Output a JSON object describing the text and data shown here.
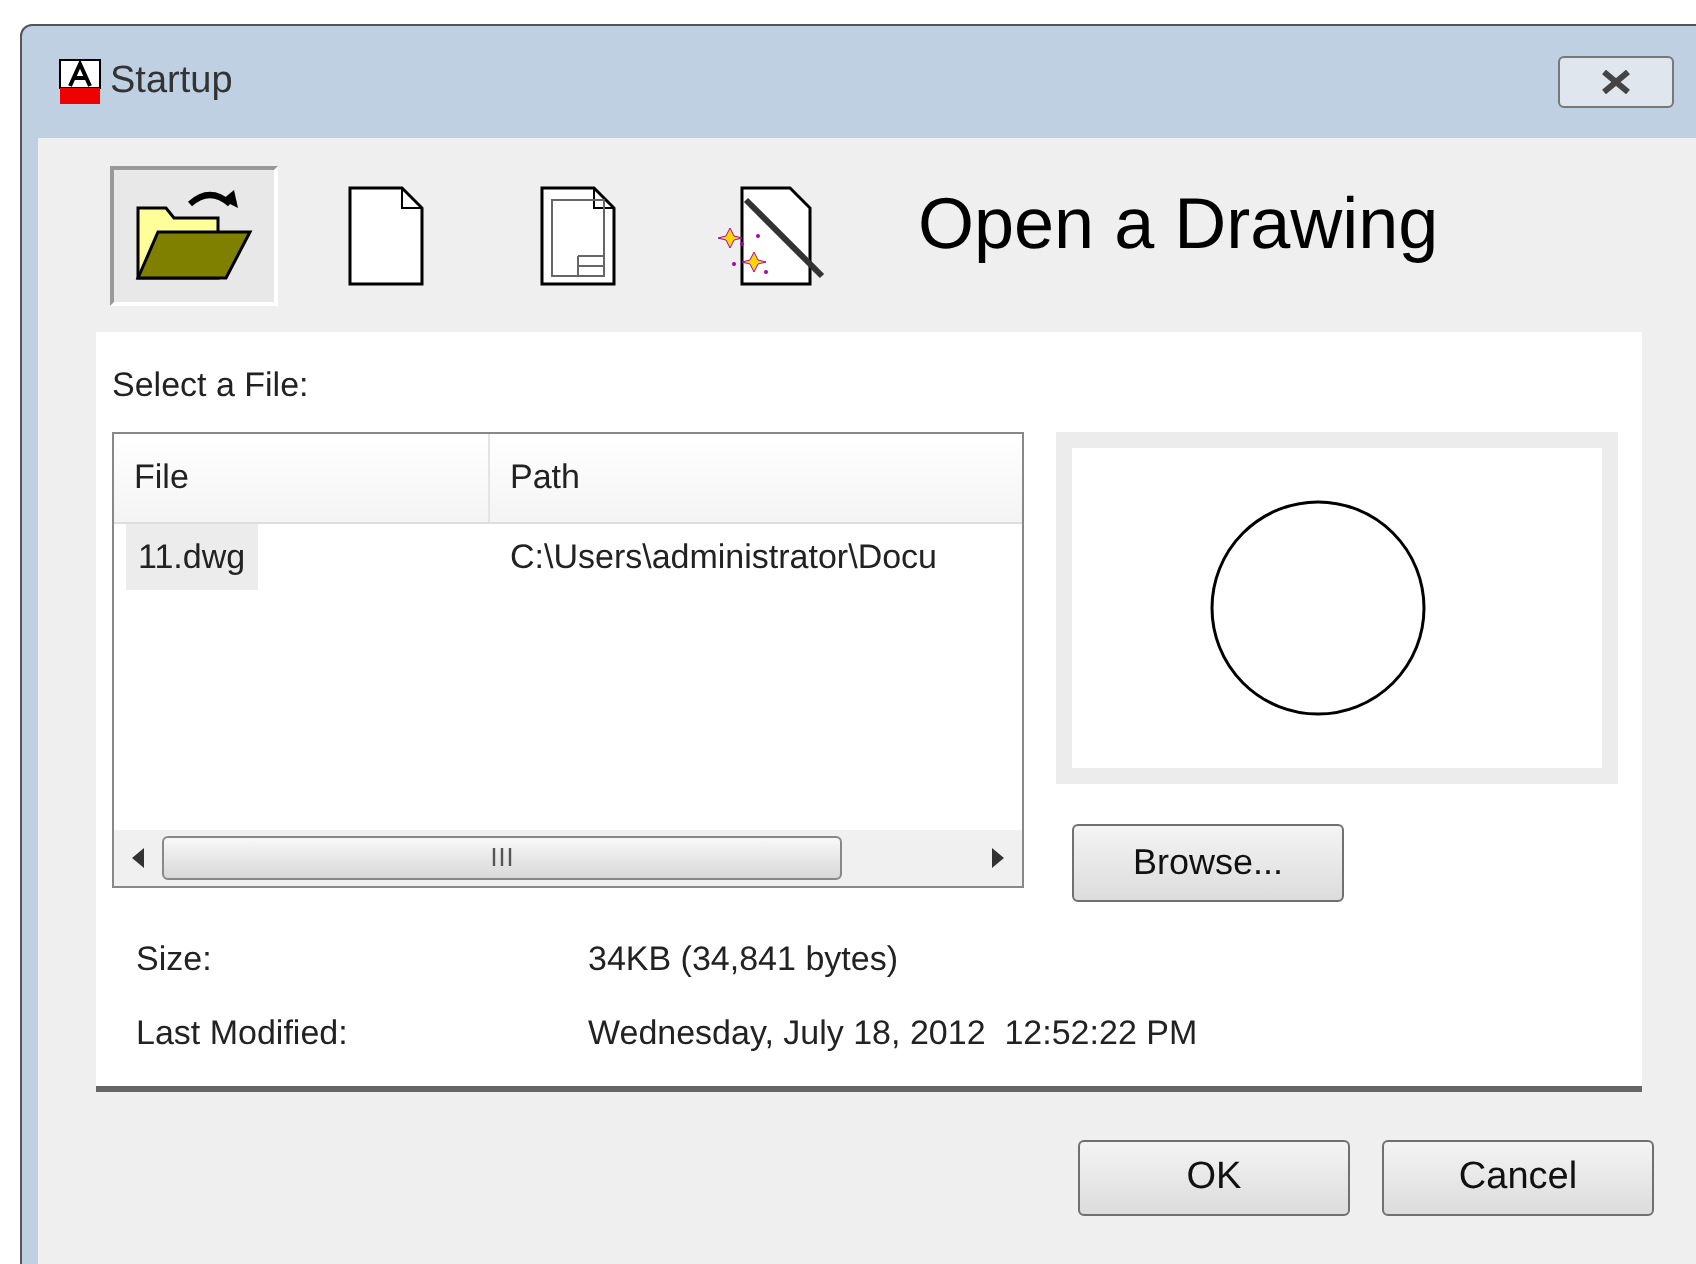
{
  "window": {
    "title": "Startup"
  },
  "tabs": [
    {
      "kind": "open",
      "selected": true
    },
    {
      "kind": "blank",
      "selected": false
    },
    {
      "kind": "template",
      "selected": false
    },
    {
      "kind": "wizard",
      "selected": false
    }
  ],
  "heading": "Open a Drawing",
  "file_list": {
    "label": "Select a File:",
    "columns": [
      "File",
      "Path"
    ],
    "rows": [
      {
        "file": "11.dwg",
        "path": "C:\\Users\\administrator\\Docu",
        "selected": true
      }
    ]
  },
  "browse_button": "Browse...",
  "details": [
    {
      "label": "Size:",
      "value": "34KB (34,841 bytes)"
    },
    {
      "label": "Last Modified:",
      "value": "Wednesday, July 18, 2012  12:52:22 PM"
    }
  ],
  "buttons": [
    "OK",
    "Cancel"
  ]
}
